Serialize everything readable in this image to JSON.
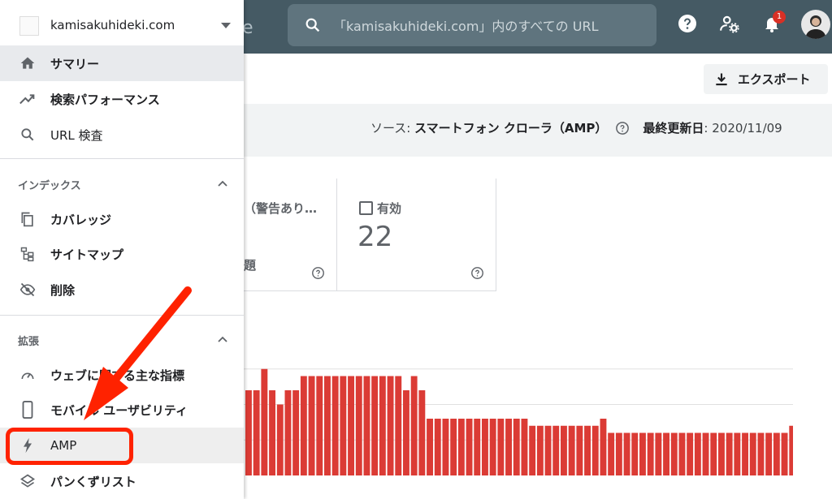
{
  "header": {
    "title_fragment": "e",
    "search_placeholder": "「kamisakuhideki.com」内のすべての URL",
    "notification_count": "1",
    "icons": [
      "search-icon",
      "help-icon",
      "admin-settings-icon",
      "bell-icon",
      "avatar"
    ]
  },
  "toolbar": {
    "export_label": "エクスポート"
  },
  "source": {
    "label": "ソース",
    "value": "スマートフォン クローラ（AMP）",
    "updated_label": "最終更新日",
    "updated_value": "2020/11/09"
  },
  "cards": [
    {
      "label": "（警告あり…",
      "sub": "題"
    },
    {
      "label": "有効",
      "value": "22"
    }
  ],
  "sidebar": {
    "property": "kamisakuhideki.com",
    "items_top": [
      {
        "label": "サマリー",
        "icon": "home-icon"
      },
      {
        "label": "検索パフォーマンス",
        "icon": "trending-icon"
      },
      {
        "label": "URL 検査",
        "icon": "search-icon"
      }
    ],
    "section_index": "インデックス",
    "items_index": [
      {
        "label": "カバレッジ",
        "icon": "coverage-icon"
      },
      {
        "label": "サイトマップ",
        "icon": "sitemap-icon"
      },
      {
        "label": "削除",
        "icon": "eye-off-icon"
      }
    ],
    "section_enh": "拡張",
    "items_enh": [
      {
        "label": "ウェブに関する主な指標",
        "icon": "speed-icon"
      },
      {
        "label": "モバイル ユーザビリティ",
        "icon": "phone-icon"
      },
      {
        "label": "AMP",
        "icon": "bolt-icon"
      },
      {
        "label": "パンくずリスト",
        "icon": "layers-icon"
      }
    ]
  },
  "chart_data": {
    "type": "bar",
    "color": "#db3b35",
    "series": [
      {
        "values": [
          12,
          12,
          15,
          12,
          10,
          12,
          12,
          14,
          14,
          14,
          14,
          14,
          14,
          14,
          14,
          14,
          14,
          14,
          14,
          14,
          12,
          14,
          12,
          8,
          8,
          8,
          8,
          8,
          8,
          8,
          8,
          8,
          8,
          8,
          8,
          8,
          7,
          7,
          7,
          7,
          7,
          7,
          7,
          7,
          7,
          8,
          6,
          6,
          6,
          6,
          6,
          6,
          6,
          6,
          6,
          6,
          6,
          6,
          6,
          6,
          6,
          6,
          6,
          6,
          6,
          6,
          6,
          6,
          6,
          7,
          7,
          7,
          7
        ]
      }
    ],
    "ylim": [
      0,
      20
    ],
    "grid": true
  }
}
